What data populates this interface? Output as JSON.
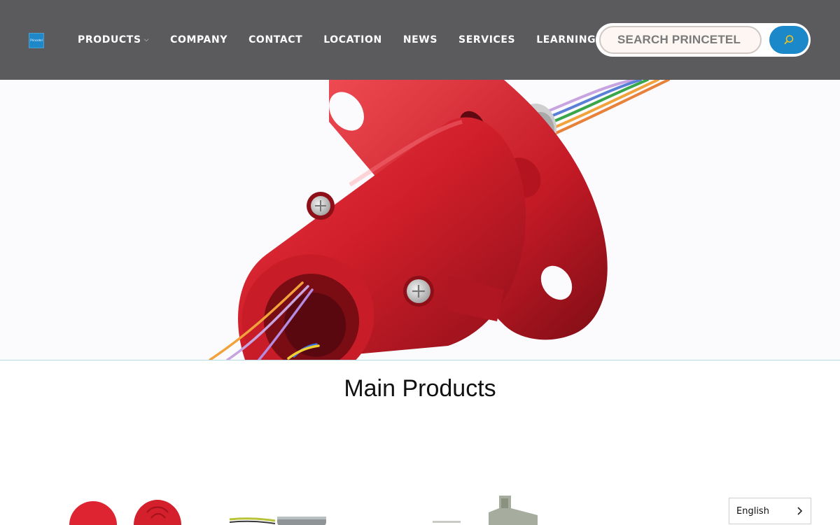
{
  "header": {
    "logo_text": "Princetel",
    "nav": [
      {
        "label": "PRODUCTS",
        "has_dropdown": true
      },
      {
        "label": "COMPANY"
      },
      {
        "label": "CONTACT"
      },
      {
        "label": "LOCATION"
      },
      {
        "label": "NEWS"
      },
      {
        "label": "SERVICES"
      },
      {
        "label": "LEARNING"
      }
    ],
    "search": {
      "placeholder": "SEARCH PRINCETEL",
      "button_icon": "search-icon"
    }
  },
  "hero": {
    "image": "red-slip-ring-product-photo"
  },
  "main": {
    "section_title": "Main Products"
  },
  "language": {
    "selected": "English"
  },
  "colors": {
    "header_bg": "#5b5a5c",
    "accent_blue": "#1a88c9",
    "product_red": "#d8232f"
  }
}
